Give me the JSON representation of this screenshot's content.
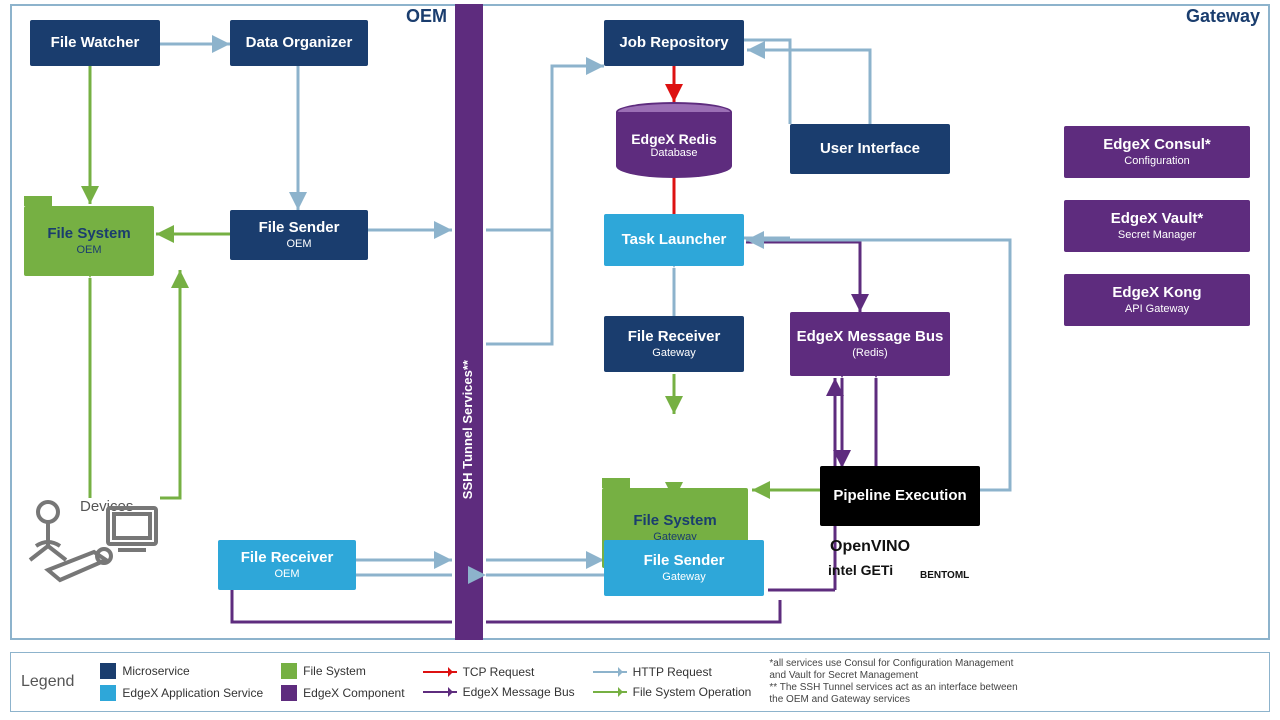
{
  "regions": {
    "oem": "OEM",
    "gateway": "Gateway"
  },
  "nodes": {
    "file_watcher": {
      "title": "File Watcher"
    },
    "data_organizer": {
      "title": "Data Organizer"
    },
    "file_sender_oem": {
      "title": "File Sender",
      "sub": "OEM"
    },
    "fs_oem": {
      "title": "File System",
      "sub": "OEM"
    },
    "file_receiver_oem": {
      "title": "File Receiver",
      "sub": "OEM"
    },
    "job_repo": {
      "title": "Job Repository"
    },
    "edgex_redis": {
      "title": "EdgeX Redis",
      "sub": "Database"
    },
    "user_interface": {
      "title": "User Interface"
    },
    "task_launcher": {
      "title": "Task Launcher"
    },
    "file_receiver_gw": {
      "title": "File Receiver",
      "sub": "Gateway"
    },
    "edgex_msgbus": {
      "title": "EdgeX Message Bus",
      "sub": "(Redis)"
    },
    "fs_gw": {
      "title": "File System",
      "sub": "Gateway"
    },
    "file_sender_gw": {
      "title": "File Sender",
      "sub": "Gateway"
    },
    "pipeline_exec": {
      "title": "Pipeline Execution"
    },
    "edgex_consul": {
      "title": "EdgeX Consul*",
      "sub": "Configuration"
    },
    "edgex_vault": {
      "title": "EdgeX Vault*",
      "sub": "Secret Manager"
    },
    "edgex_kong": {
      "title": "EdgeX Kong",
      "sub": "API Gateway"
    }
  },
  "ssh_label": "SSH Tunnel Services**",
  "devices_label": "Devices",
  "logos": {
    "openvino": "OpenVINO",
    "geti": "intel GETi",
    "bentoml": "BENTOML"
  },
  "legend": {
    "title": "Legend",
    "microservice": "Microservice",
    "appservice": "EdgeX Application Service",
    "filesystem": "File System",
    "edgex": "EdgeX Component",
    "tcp": "TCP Request",
    "msgbus": "EdgeX Message Bus",
    "http": "HTTP Request",
    "fsop": "File System Operation",
    "note1": "*all services use Consul for Configuration Management and Vault for Secret Management",
    "note2": "** The SSH Tunnel services act as an interface between the OEM and Gateway services"
  }
}
